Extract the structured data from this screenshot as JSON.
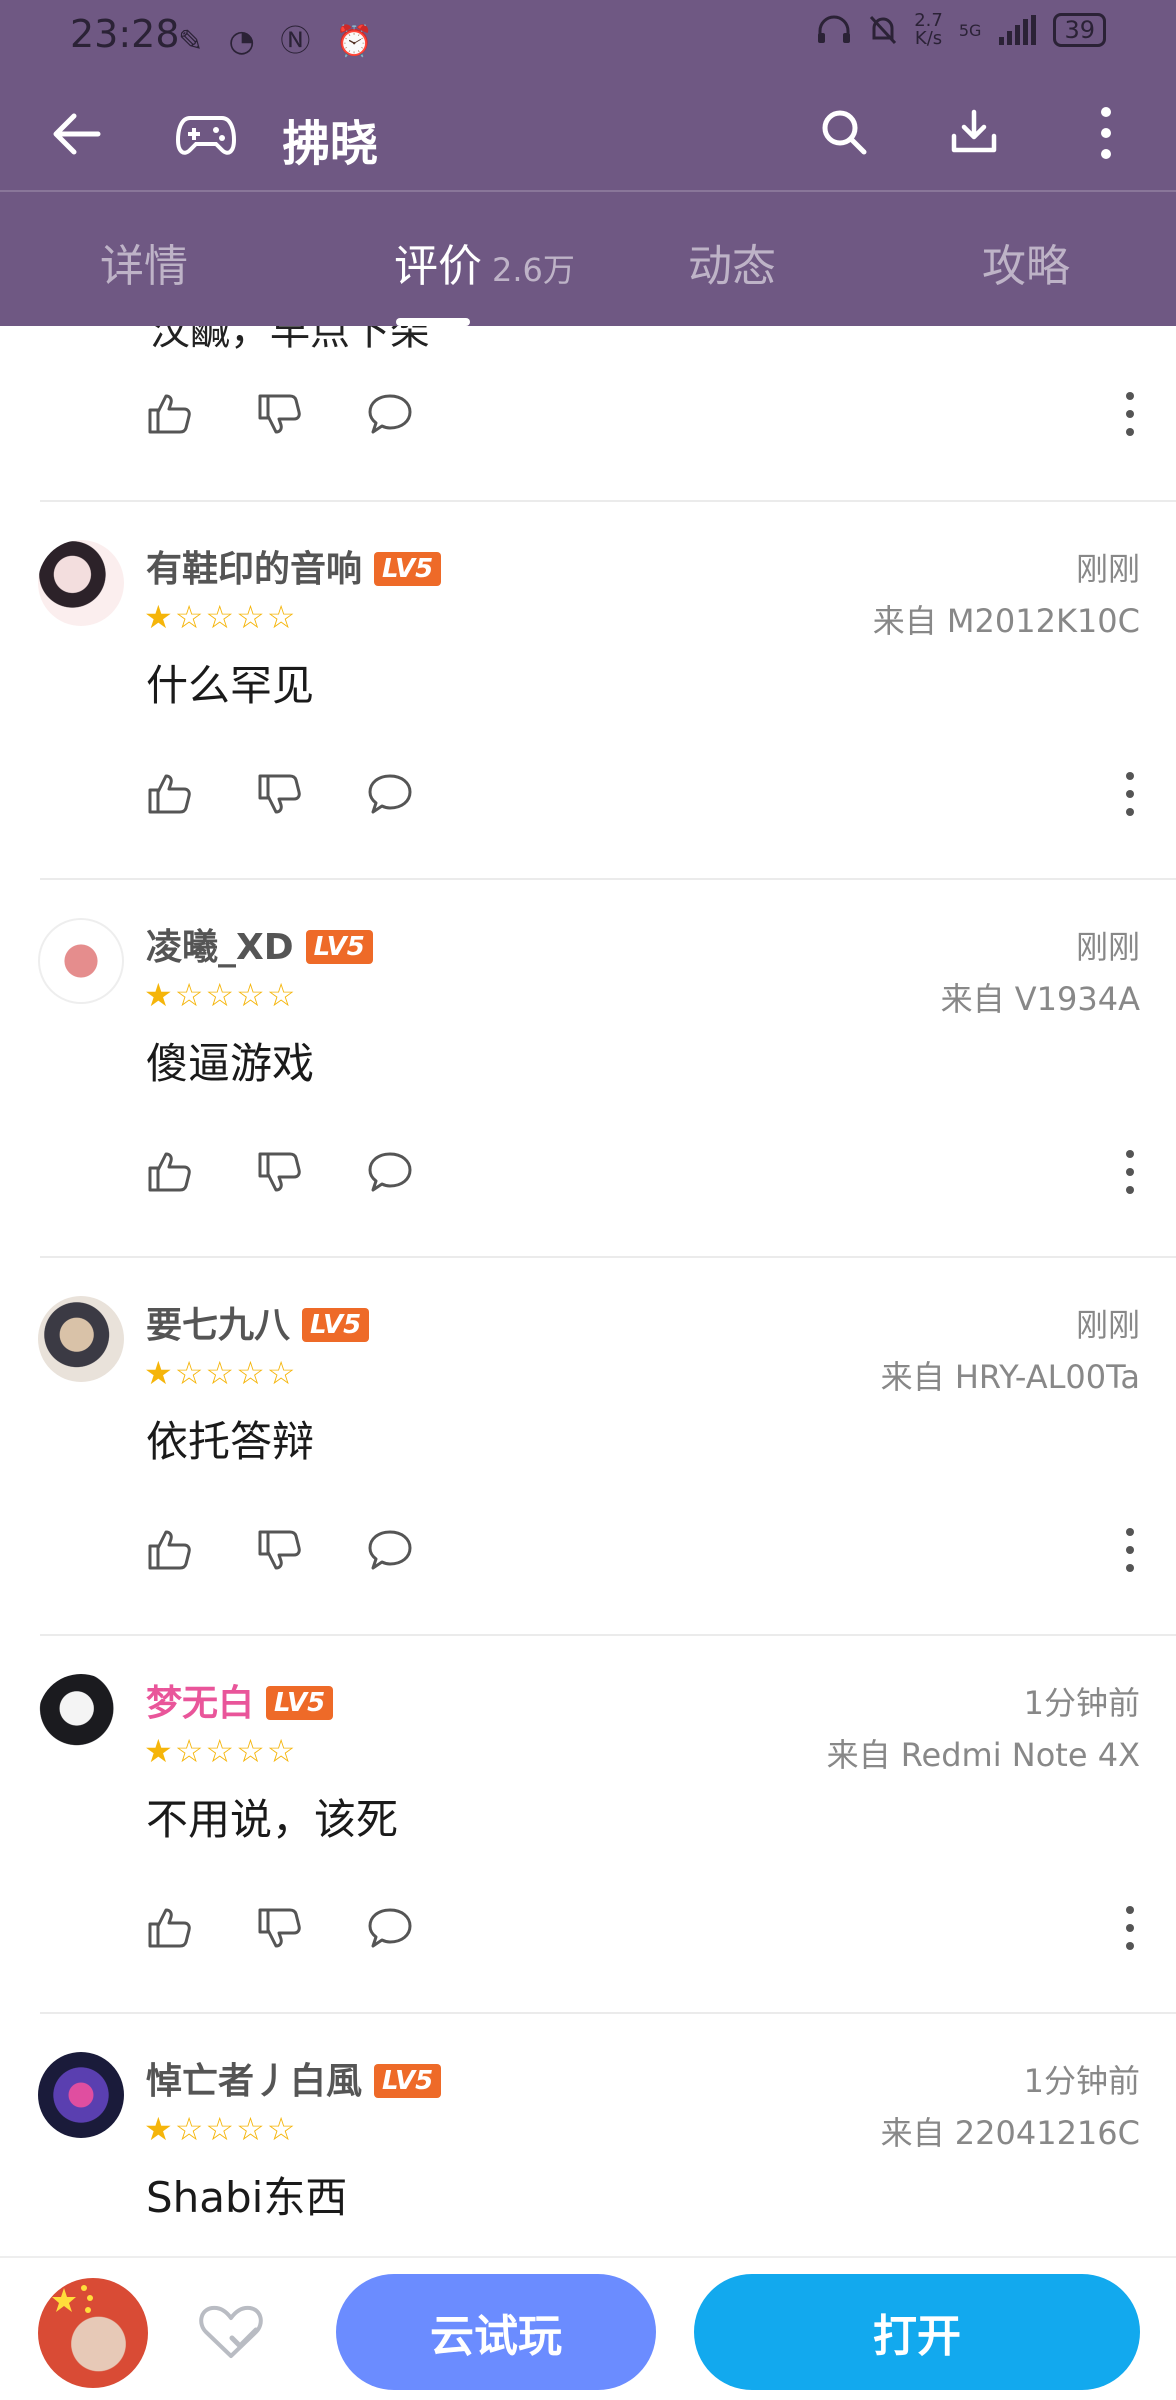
{
  "status_bar": {
    "time": "23:28",
    "left_icons": "✎ ◔ Ⓝ ⏰",
    "net_speed_value": "2.7",
    "net_speed_unit": "K/s",
    "signal": "5G",
    "battery": "39"
  },
  "toolbar": {
    "title": "拂晓"
  },
  "tabs": [
    {
      "label": "详情"
    },
    {
      "label": "评价",
      "count": "2.6万"
    },
    {
      "label": "动态"
    },
    {
      "label": "攻略"
    }
  ],
  "partial_review": {
    "text": "汶鹹，早点下架"
  },
  "reviews": [
    {
      "username": "有鞋印的音响",
      "level": "LV5",
      "stars": "★☆☆☆☆",
      "time": "刚刚",
      "device": "来自 M2012K10C",
      "text": "什么罕见"
    },
    {
      "username": "凌曦_XD",
      "level": "LV5",
      "stars": "★☆☆☆☆",
      "time": "刚刚",
      "device": "来自 V1934A",
      "text": "傻逼游戏"
    },
    {
      "username": "要七九八",
      "level": "LV5",
      "stars": "★☆☆☆☆",
      "time": "刚刚",
      "device": "来自 HRY-AL00Ta",
      "text": "依托答辩"
    },
    {
      "username": "梦无白",
      "level": "LV5",
      "stars": "★☆☆☆☆",
      "time": "1分钟前",
      "device": "来自 Redmi Note 4X",
      "text": "不用说，该死"
    },
    {
      "username": "悼亡者丿白風",
      "level": "LV5",
      "stars": "★☆☆☆☆",
      "time": "1分钟前",
      "device": "来自 22041216C",
      "text": "Shabi东西"
    }
  ],
  "bottom_bar": {
    "cloud_play": "云试玩",
    "open": "打开"
  },
  "colors": {
    "header_bg": "#6f5883",
    "star": "#f5b50a",
    "level_badge": "#ee6a28",
    "cloud_button": "#6b8cff",
    "open_button": "#12a9ee",
    "pink_username": "#e9559a"
  }
}
